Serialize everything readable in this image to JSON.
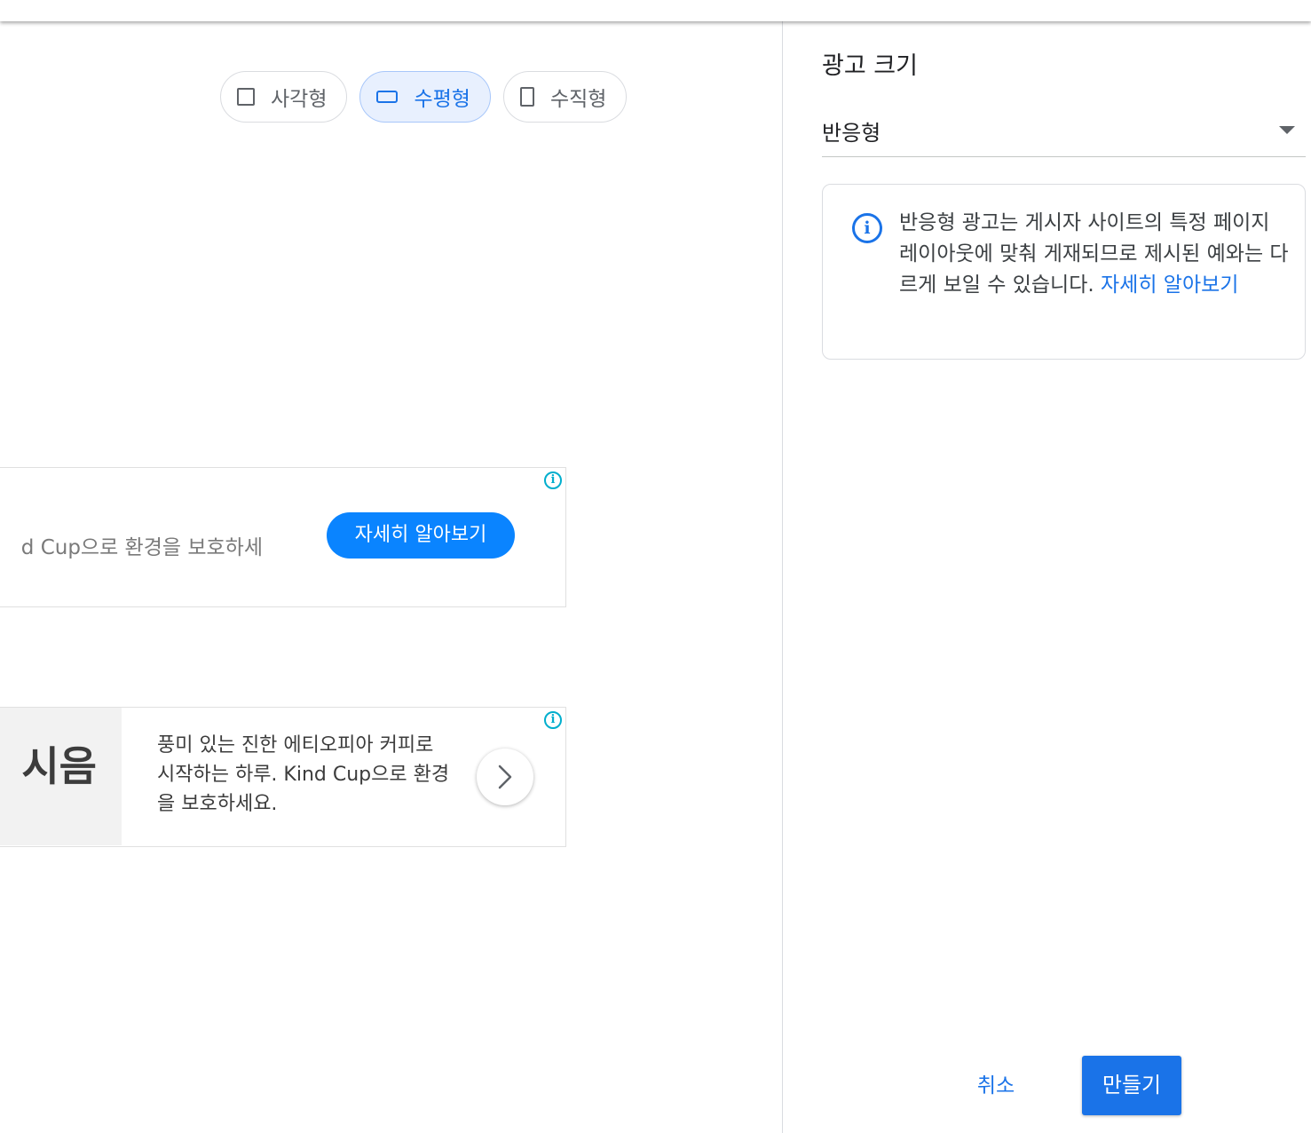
{
  "preview": {
    "shape_options": [
      {
        "label": "사각형",
        "icon": "square-icon",
        "selected": false
      },
      {
        "label": "수평형",
        "icon": "horizontal-rectangle-icon",
        "selected": true
      },
      {
        "label": "수직형",
        "icon": "vertical-rectangle-icon",
        "selected": false
      }
    ],
    "ad1": {
      "text": "d Cup으로 환경을 보호하세",
      "button_label": "자세히 알아보기",
      "adchoices_glyph": "i"
    },
    "ad2": {
      "headline": "시음",
      "body": "풍미 있는 진한 에티오피아 커피로 시작하는 하루. Kind Cup으로 환경을 보호하세요.",
      "adchoices_glyph": "i"
    }
  },
  "panel": {
    "title": "광고 크기",
    "select": {
      "value": "반응형"
    },
    "info": {
      "icon_glyph": "i",
      "text": "반응형 광고는 게시자 사이트의 특정 페이지 레이아웃에 맞춰 게재되므로 제시된 예와는 다르게 보일 수 있습니다. ",
      "link_label": "자세히 알아보기"
    },
    "cancel_label": "취소",
    "create_label": "만들기"
  },
  "colors": {
    "accent": "#1a73e8",
    "ad_button": "#0a84ff",
    "adchoices": "#00aecd",
    "chip_selected_bg": "#e8f0fe"
  }
}
